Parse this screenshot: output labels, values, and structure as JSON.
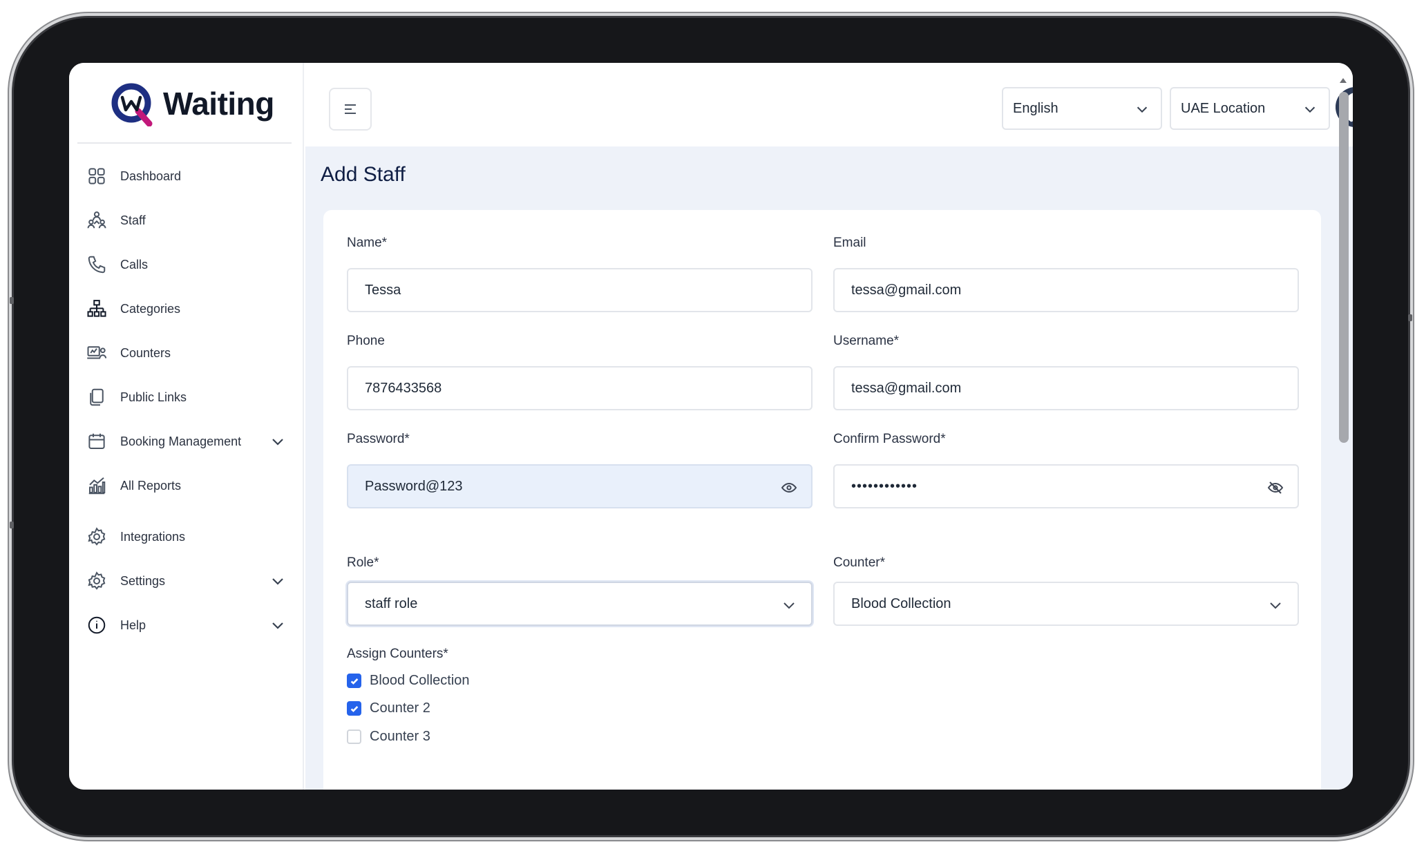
{
  "brand": {
    "name": "Waiting"
  },
  "sidebar": {
    "items": [
      {
        "label": "Dashboard",
        "icon": "dashboard-icon"
      },
      {
        "label": "Staff",
        "icon": "staff-icon"
      },
      {
        "label": "Calls",
        "icon": "phone-icon"
      },
      {
        "label": "Categories",
        "icon": "categories-icon"
      },
      {
        "label": "Counters",
        "icon": "counters-icon"
      },
      {
        "label": "Public Links",
        "icon": "public-links-icon"
      },
      {
        "label": "Booking Management",
        "icon": "calendar-icon",
        "expandable": true
      },
      {
        "label": "All Reports",
        "icon": "reports-icon"
      },
      {
        "label": "Integrations",
        "icon": "integrations-icon"
      },
      {
        "label": "Settings",
        "icon": "settings-icon",
        "expandable": true
      },
      {
        "label": "Help",
        "icon": "help-icon",
        "expandable": true
      }
    ]
  },
  "header": {
    "language": "English",
    "location": "UAE Location"
  },
  "page": {
    "title": "Add Staff"
  },
  "form": {
    "name": {
      "label": "Name*",
      "value": "Tessa"
    },
    "email": {
      "label": "Email",
      "value": "tessa@gmail.com"
    },
    "phone": {
      "label": "Phone",
      "value": "7876433568"
    },
    "username": {
      "label": "Username*",
      "value": "tessa@gmail.com"
    },
    "password": {
      "label": "Password*",
      "value": "Password@123"
    },
    "confirm_password": {
      "label": "Confirm Password*",
      "value": "••••••••••••"
    },
    "role": {
      "label": "Role*",
      "value": "staff role"
    },
    "counter": {
      "label": "Counter*",
      "value": "Blood Collection"
    },
    "assign_counters": {
      "label": "Assign Counters*",
      "options": [
        {
          "label": "Blood Collection",
          "checked": true
        },
        {
          "label": "Counter 2",
          "checked": true
        },
        {
          "label": "Counter 3",
          "checked": false
        }
      ]
    }
  },
  "colors": {
    "brand": "#1e2f82",
    "accent": "#2563eb",
    "content_bg": "#eef2f9",
    "title": "#0f1e44"
  }
}
